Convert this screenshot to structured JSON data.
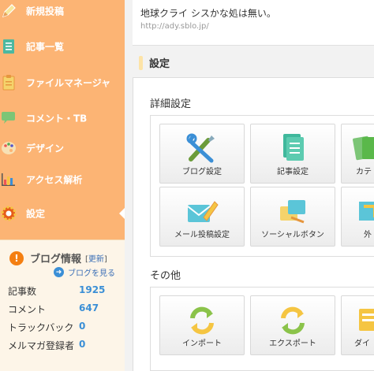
{
  "sidebar": {
    "items": [
      {
        "label": "新規投稿",
        "icon": "pencil-icon"
      },
      {
        "label": "記事一覧",
        "icon": "document-list-icon"
      },
      {
        "label": "ファイルマネージャ",
        "icon": "clipboard-icon"
      },
      {
        "label": "コメント・TB",
        "icon": "comment-bubble-icon"
      },
      {
        "label": "デザイン",
        "icon": "palette-icon"
      },
      {
        "label": "アクセス解析",
        "icon": "bar-chart-icon"
      },
      {
        "label": "設定",
        "icon": "gear-icon",
        "active": true
      }
    ]
  },
  "blog_info": {
    "title": "ブログ情報",
    "refresh_label": "更新",
    "view_blog": "ブログを見る",
    "stats": [
      {
        "label": "記事数",
        "value": "1925"
      },
      {
        "label": "コメント",
        "value": "647"
      },
      {
        "label": "トラックバック",
        "value": "0"
      },
      {
        "label": "メルマガ登録者",
        "value": "0"
      }
    ]
  },
  "header": {
    "blog_title": "地球クライ シスかな処は無い。",
    "blog_url": "http://ady.sblo.jp/"
  },
  "page_title": "設定",
  "sections": [
    {
      "title": "詳細設定",
      "tiles": [
        "ブログ設定",
        "記事設定",
        "カテ",
        "メール投稿設定",
        "ソーシャルボタン",
        "外"
      ]
    },
    {
      "title": "その他",
      "tiles": [
        "インポート",
        "エクスポート",
        "ダイ"
      ]
    }
  ],
  "colors": {
    "sidebar": "#fcb474",
    "accent": "#3b8fd6",
    "warn": "#f47f12"
  }
}
